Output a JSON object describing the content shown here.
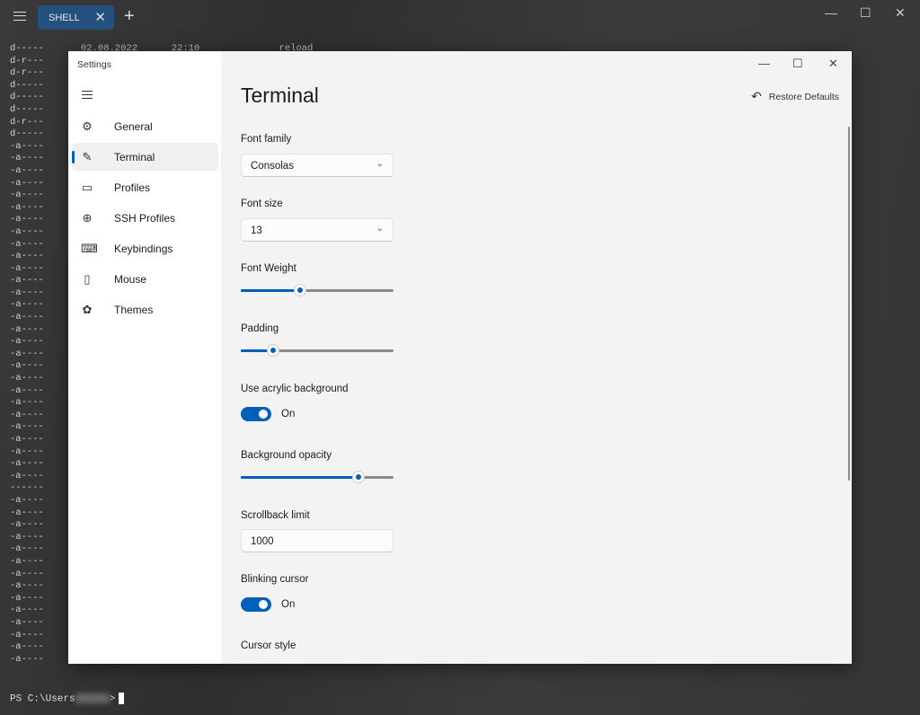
{
  "tabbar": {
    "tab_label": "SHELL",
    "close": "✕",
    "new_tab": "+",
    "minimize": "—",
    "maximize": "☐",
    "close_window": "✕"
  },
  "terminal": {
    "header_visible": "02.08.2022      22:10              reload",
    "modes": [
      "d-----",
      "d-r---",
      "d-r---",
      "d-----",
      "d-----",
      "d-----",
      "d-r---",
      "d-----",
      "-a----",
      "-a----",
      "-a----",
      "-a----",
      "-a----",
      "-a----",
      "-a----",
      "-a----",
      "-a----",
      "-a----",
      "-a----",
      "-a----",
      "-a----",
      "-a----",
      "-a----",
      "-a----",
      "-a----",
      "-a----",
      "-a----",
      "-a----",
      "-a----",
      "-a----",
      "-a----",
      "-a----",
      "-a----",
      "-a----",
      "-a----",
      "-a----",
      "------",
      "-a----",
      "-a----",
      "-a----",
      "-a----",
      "-a----",
      "-a----",
      "-a----",
      "-a----",
      "-a----",
      "-a----",
      "-a----",
      "-a----",
      "-a----",
      "-a----"
    ],
    "prompt": "PS C:\\Users",
    "prompt_end": ">"
  },
  "settings": {
    "window_title": "Settings",
    "minimize": "—",
    "maximize": "☐",
    "close": "✕",
    "nav": [
      {
        "label": "General",
        "icon": "gear-icon",
        "glyph": "⚙"
      },
      {
        "label": "Terminal",
        "icon": "terminal-edit-icon",
        "glyph": "✎",
        "selected": true
      },
      {
        "label": "Profiles",
        "icon": "profiles-icon",
        "glyph": "▭"
      },
      {
        "label": "SSH Profiles",
        "icon": "globe-icon",
        "glyph": "⊕"
      },
      {
        "label": "Keybindings",
        "icon": "keyboard-icon",
        "glyph": "⌨"
      },
      {
        "label": "Mouse",
        "icon": "mouse-icon",
        "glyph": "▯"
      },
      {
        "label": "Themes",
        "icon": "palette-icon",
        "glyph": "✿"
      }
    ],
    "page_title": "Terminal",
    "restore_defaults": "Restore Defaults",
    "font_family": {
      "label": "Font family",
      "value": "Consolas"
    },
    "font_size": {
      "label": "Font size",
      "value": "13"
    },
    "font_weight": {
      "label": "Font Weight",
      "percent": 39
    },
    "padding": {
      "label": "Padding",
      "percent": 21
    },
    "acrylic": {
      "label": "Use acrylic background",
      "state": "On"
    },
    "opacity": {
      "label": "Background opacity",
      "percent": 77
    },
    "scrollback": {
      "label": "Scrollback limit",
      "value": "1000"
    },
    "blinking": {
      "label": "Blinking cursor",
      "state": "On"
    },
    "cursor_style": {
      "label": "Cursor style"
    }
  },
  "colors": {
    "accent": "#005fb8",
    "tab": "#23507e"
  }
}
